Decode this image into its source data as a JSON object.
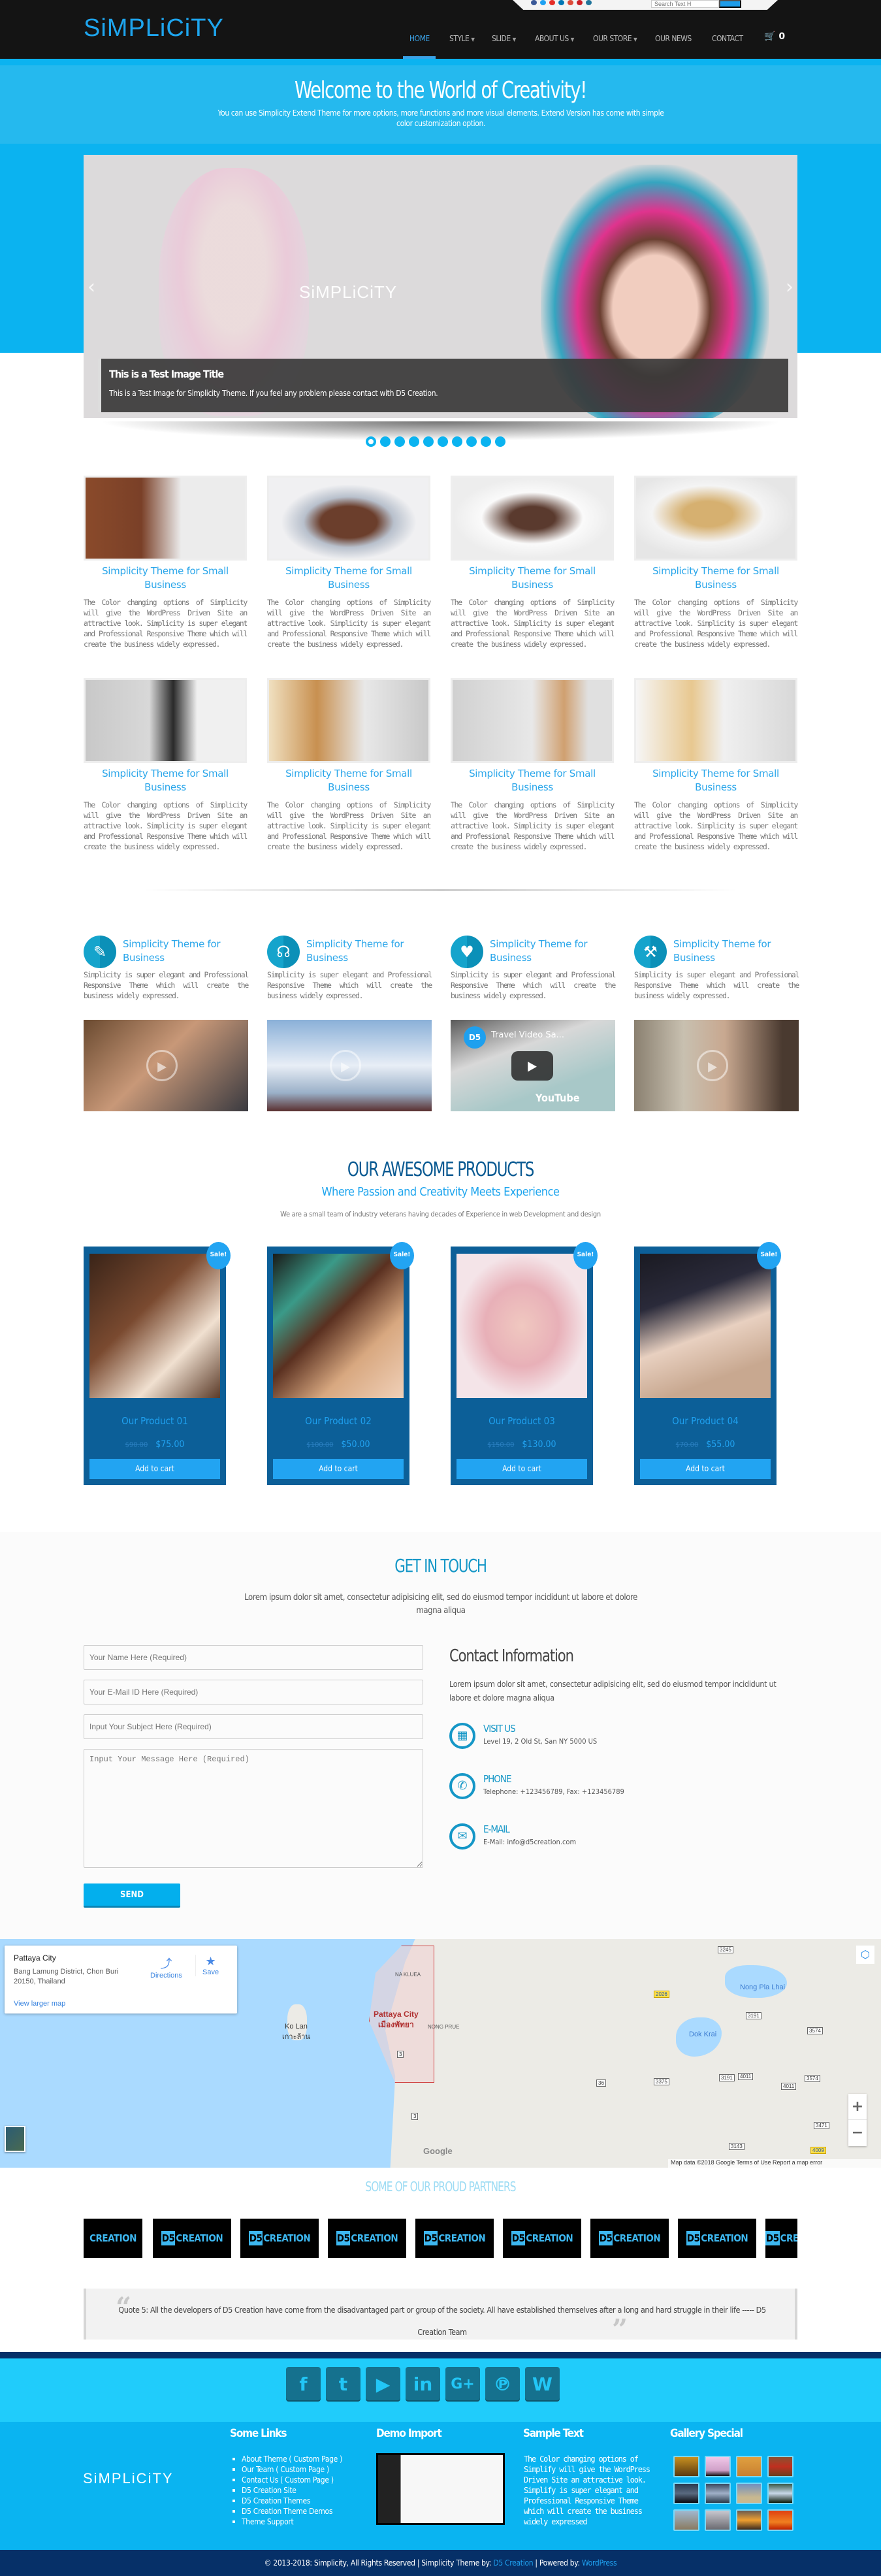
{
  "header": {
    "logo": "SiMPLiCiTY",
    "search_placeholder": "Search Text H",
    "nav": [
      {
        "label": "HOME",
        "active": true,
        "has_dropdown": false
      },
      {
        "label": "STYLE",
        "has_dropdown": true
      },
      {
        "label": "SLIDE",
        "has_dropdown": true
      },
      {
        "label": "ABOUT US",
        "has_dropdown": true
      },
      {
        "label": "OUR STORE",
        "has_dropdown": true
      },
      {
        "label": "OUR NEWS",
        "has_dropdown": false
      },
      {
        "label": "CONTACT",
        "has_dropdown": false
      }
    ],
    "cart_count": "0",
    "cart_icon": "shopping-cart-icon"
  },
  "welcome": {
    "title": "Welcome to the World of Creativity!",
    "text": "You can use Simplicity Extend Theme for more options, more functions and more visual elements. Extend Version has come with simple color customization option."
  },
  "slider": {
    "logo_text": "SiMPLiCiTY",
    "prev": "‹",
    "next": "›",
    "caption_title": "This is a Test Image Title",
    "caption_text": "This is a Test Image for Simplicity Theme. If you feel any problem please contact with D5 Creation.",
    "slide_count": 10,
    "active_slide": 1
  },
  "features": [
    {
      "title": "Simplicity Theme for Small Business",
      "text": "The Color changing options of Simplicity will give the WordPress Driven Site an attractive look. Simplicity is super elegant and Professional Responsive Theme which will create the business widely expressed."
    },
    {
      "title": "Simplicity Theme for Small Business",
      "text": "The Color changing options of Simplicity will give the WordPress Driven Site an attractive look. Simplicity is super elegant and Professional Responsive Theme which will create the business widely expressed."
    },
    {
      "title": "Simplicity Theme for Small Business",
      "text": "The Color changing options of Simplicity will give the WordPress Driven Site an attractive look. Simplicity is super elegant and Professional Responsive Theme which will create the business widely expressed."
    },
    {
      "title": "Simplicity Theme for Small Business",
      "text": "The Color changing options of Simplicity will give the WordPress Driven Site an attractive look. Simplicity is super elegant and Professional Responsive Theme which will create the business widely expressed."
    },
    {
      "title": "Simplicity Theme for Small Business",
      "text": "The Color changing options of Simplicity will give the WordPress Driven Site an attractive look. Simplicity is super elegant and Professional Responsive Theme which will create the business widely expressed."
    },
    {
      "title": "Simplicity Theme for Small Business",
      "text": "The Color changing options of Simplicity will give the WordPress Driven Site an attractive look. Simplicity is super elegant and Professional Responsive Theme which will create the business widely expressed."
    },
    {
      "title": "Simplicity Theme for Small Business",
      "text": "The Color changing options of Simplicity will give the WordPress Driven Site an attractive look. Simplicity is super elegant and Professional Responsive Theme which will create the business widely expressed."
    },
    {
      "title": "Simplicity Theme for Small Business",
      "text": "The Color changing options of Simplicity will give the WordPress Driven Site an attractive look. Simplicity is super elegant and Professional Responsive Theme which will create the business widely expressed."
    }
  ],
  "services": [
    {
      "icon": "clipboard-pen-icon",
      "glyph": "✎",
      "title": "Simplicity Theme for Business",
      "text": "Simplicity is super elegant and Professional Responsive Theme which will create the business widely expressed."
    },
    {
      "icon": "voice-speaking-icon",
      "glyph": "☊",
      "title": "Simplicity Theme for Business",
      "text": "Simplicity is super elegant and Professional Responsive Theme which will create the business widely expressed."
    },
    {
      "icon": "heart-icon",
      "glyph": "♥",
      "title": "Simplicity Theme for Business",
      "text": "Simplicity is super elegant and Professional Responsive Theme which will create the business widely expressed."
    },
    {
      "icon": "tools-document-icon",
      "glyph": "⚒",
      "title": "Simplicity Theme for Business",
      "text": "Simplicity is super elegant and Professional Responsive Theme which will create the business widely expressed."
    }
  ],
  "videos": {
    "youtube_title": "Travel Video Sa...",
    "youtube_channel": "D5",
    "youtube_brand": "YouTube"
  },
  "products": {
    "title": "OUR AWESOME PRODUCTS",
    "subtitle": "Where Passion and Creativity Meets Experience",
    "description": "We are a small team of industry veterans having decades of Experience in web Development and design",
    "items": [
      {
        "name": "Our Product 01",
        "old_price": "$90.00",
        "price": "$75.00",
        "badge": "Sale!",
        "button": "Add to cart"
      },
      {
        "name": "Our Product 02",
        "old_price": "$100.00",
        "price": "$50.00",
        "badge": "Sale!",
        "button": "Add to cart"
      },
      {
        "name": "Our Product 03",
        "old_price": "$150.00",
        "price": "$130.00",
        "badge": "Sale!",
        "button": "Add to cart"
      },
      {
        "name": "Our Product 04",
        "old_price": "$70.00",
        "price": "$55.00",
        "badge": "Sale!",
        "button": "Add to cart"
      }
    ]
  },
  "contact": {
    "title": "GET IN TOUCH",
    "description": "Lorem ipsum dolor sit amet, consectetur adipisicing elit, sed do eiusmod tempor incididunt ut labore et dolore magna aliqua",
    "form": {
      "name_placeholder": "Your Name Here (Required)",
      "email_placeholder": "Your E-Mail ID Here (Required)",
      "subject_placeholder": "Input Your Subject Here (Required)",
      "message_placeholder": "Input Your Message Here (Required)",
      "send": "SEND"
    },
    "info_title": "Contact Information",
    "info_text": "Lorem ipsum dolor sit amet, consectetur adipisicing elit, sed do eiusmod tempor incididunt ut labore et dolore magna aliqua",
    "items": [
      {
        "icon": "building-icon",
        "glyph": "▦",
        "label": "VISIT US",
        "value": "Level 19, 2 Old St, San NY 5000 US"
      },
      {
        "icon": "phone-icon",
        "glyph": "✆",
        "label": "PHONE",
        "value": "Telephone: +123456789, Fax: +123456789"
      },
      {
        "icon": "envelope-icon",
        "glyph": "✉",
        "label": "E-MAIL",
        "value": "E-Mail: info@d5creation.com"
      }
    ]
  },
  "map": {
    "place": "Pattaya City",
    "address": "Bang Lamung District, Chon Buri 20150, Thailand",
    "view_larger": "View larger map",
    "directions": "Directions",
    "save": "Save",
    "labels": {
      "ko_lan": "Ko Lan",
      "ko_lan_th": "เกาะล้าน",
      "pattaya": "Pattaya City",
      "pattaya_th": "เมืองพัทยา",
      "na_kluea": "NA KLUEA",
      "nong_pla_lhai": "Nong Pla Lhai",
      "dok_krai": "Dok Krai",
      "nong_prue": "NONG PRUE"
    },
    "roads": [
      "3245",
      "2026",
      "3191",
      "3574",
      "3375",
      "3191",
      "4011",
      "4011",
      "3574",
      "36",
      "3471",
      "3143",
      "4009",
      "3",
      "3"
    ],
    "zoom_in": "+",
    "zoom_out": "−",
    "google": "Google",
    "footer": "Map data ©2018 Google   Terms of Use   Report a map error"
  },
  "partners": {
    "title": "SOME OF OUR PROUD PARTNERS",
    "logo_mark": "D5",
    "logo_text": "CREATION",
    "count": 9
  },
  "quote": {
    "text": "Quote 5: All the developers of D5 Creation have come from the disadvantaged part or group of the society. All have established themselves after a long and hard struggle in their life ----- D5 Creation Team"
  },
  "footer": {
    "socials": [
      {
        "name": "facebook-icon",
        "glyph": "f"
      },
      {
        "name": "twitter-icon",
        "glyph": "t"
      },
      {
        "name": "youtube-icon",
        "glyph": "▶"
      },
      {
        "name": "linkedin-icon",
        "glyph": "in"
      },
      {
        "name": "google-plus-icon",
        "glyph": "G+"
      },
      {
        "name": "pinterest-icon",
        "glyph": "℗"
      },
      {
        "name": "wordpress-icon",
        "glyph": "W"
      }
    ],
    "logo": "SiMPLiCiTY",
    "links_title": "Some Links",
    "links": [
      "About Theme ( Custom Page )",
      "Our Team ( Custom Page )",
      "Contact Us ( Custom Page )",
      "D5 Creation Site",
      "D5 Creation Themes",
      "D5 Creation Theme Demos",
      "Theme Support"
    ],
    "demo_title": "Demo Import",
    "sample_title": "Sample Text",
    "sample_text": "The Color changing options of Simplify will give the WordPress Driven Site an attractive look. Simplify is super elegant and Professional Responsive Theme which will create the business widely expressed",
    "gallery_title": "Gallery Special",
    "gallery_count": 12,
    "copyright_prefix": "© 2013-2018: Simplicity, All Rights Reserved | Simplicity Theme by: ",
    "copyright_author": "D5 Creation",
    "copyright_mid": " | Powered by: ",
    "copyright_powered": "WordPress"
  },
  "colors": {
    "accent": "#0bb3f0",
    "link_blue": "#2aa6ea",
    "dark_navy": "#063068",
    "product_card": "#0c5f98",
    "header_bg": "#141414"
  }
}
